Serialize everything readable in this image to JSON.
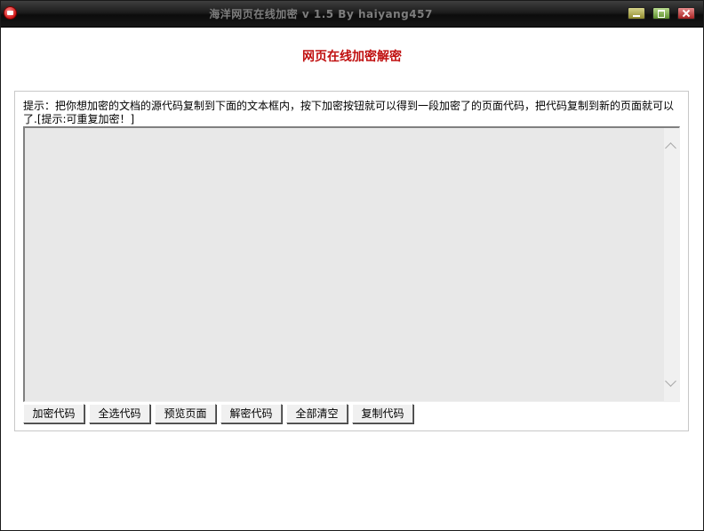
{
  "window": {
    "title": "海洋网页在线加密 v 1.5  By haiyang457"
  },
  "heading": "网页在线加密解密",
  "hint": "提示：把你想加密的文档的源代码复制到下面的文本框内，按下加密按钮就可以得到一段加密了的页面代码，把代码复制到新的页面就可以了.[提示:可重复加密！]",
  "editor": {
    "value": ""
  },
  "buttons": {
    "encrypt": "加密代码",
    "select_all": "全选代码",
    "preview": "预览页面",
    "decrypt": "解密代码",
    "clear_all": "全部清空",
    "copy": "复制代码"
  },
  "colors": {
    "heading": "#c01010",
    "titlebar": "#1c1c1c",
    "editor_bg": "#e8e8e8"
  }
}
